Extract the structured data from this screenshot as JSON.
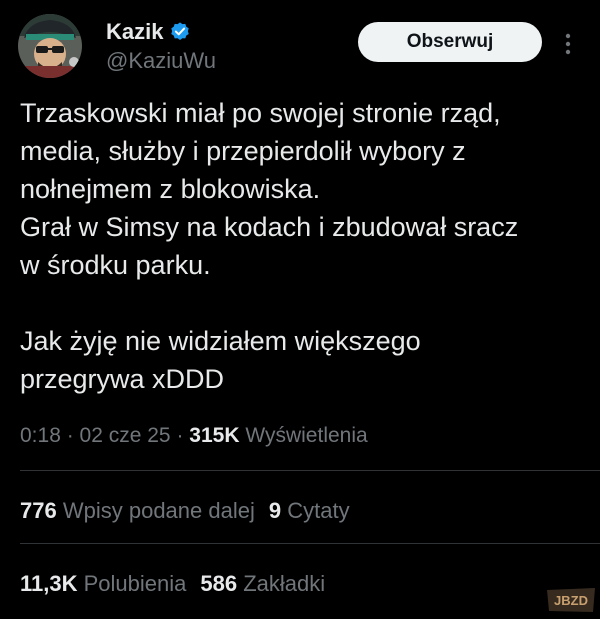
{
  "author": {
    "display_name": "Kazik",
    "handle": "@KaziuWu",
    "verified_icon": "verified-badge-icon",
    "avatar_icon": "avatar-image"
  },
  "header": {
    "follow_label": "Obserwuj",
    "more_icon": "more-options-icon"
  },
  "tweet": {
    "paragraph_1": "Trzaskowski miał po swojej stronie rząd,\nmedia, służby i przepierdolił wybory z\nnołnejmem z blokowiska.\nGrał w Simsy na kodach i zbudował sracz\nw środku parku.",
    "paragraph_2": "Jak żyję nie widziałem większego\nprzegrywa xDDD"
  },
  "meta": {
    "time": "0:18",
    "separator": " · ",
    "date": "02 cze 25",
    "views_count": "315K",
    "views_label": "Wyświetlenia"
  },
  "stats": {
    "reposts_count": "776",
    "reposts_label": "Wpisy podane dalej",
    "quotes_count": "9",
    "quotes_label": "Cytaty",
    "likes_count": "11,3K",
    "likes_label": "Polubienia",
    "bookmarks_count": "586",
    "bookmarks_label": "Zakładki"
  },
  "watermark": {
    "text": "JBZD"
  },
  "colors": {
    "background": "#000000",
    "text_primary": "#e7e9ea",
    "text_secondary": "#71767b",
    "divider": "#2f3336",
    "verified_blue": "#1d9bf0",
    "button_bg": "#eff3f4",
    "button_text": "#0f1419"
  }
}
